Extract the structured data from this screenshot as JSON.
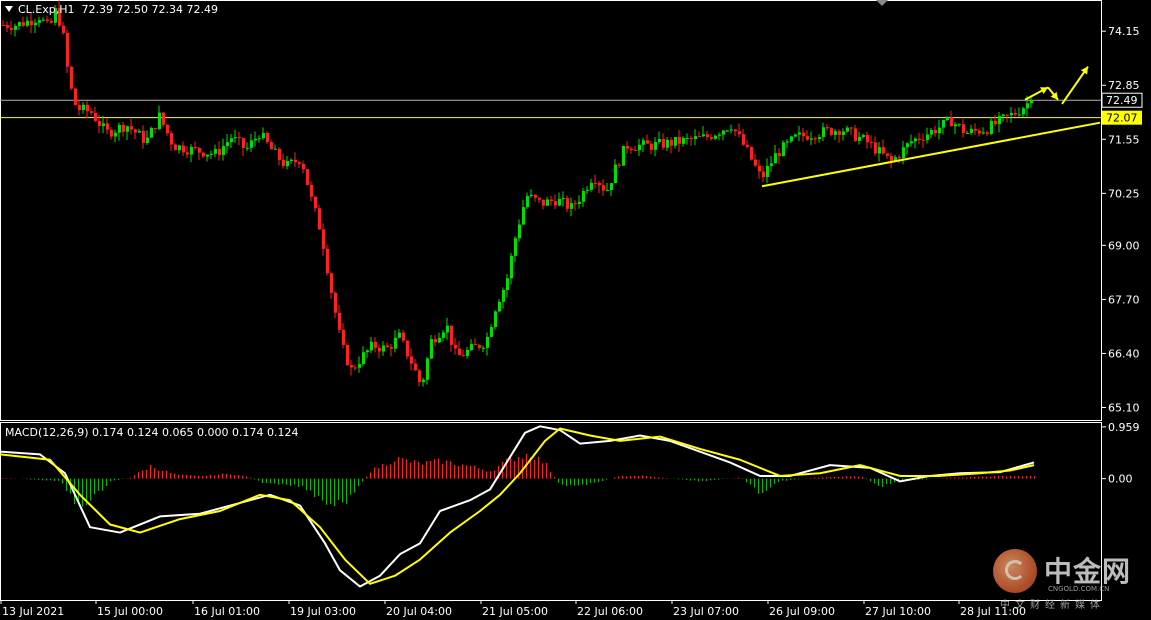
{
  "header": {
    "symbol": "CL.Exp,H1",
    "ohlc": "72.39 72.50 72.34 72.49"
  },
  "macd_header": {
    "label": "MACD(12,26,9) 0.174 0.124 0.065 0.000 0.174 0.124"
  },
  "watermark": {
    "name_cn": "中金网",
    "domain": "CNGOLD.COM.CN",
    "tagline": "中文财经新媒体",
    "logo_icon": "cngold-logo-icon"
  },
  "colors": {
    "background": "#000000",
    "bull": "#00e000",
    "bear": "#ff2020",
    "grid_line": "#b0b0b0",
    "horizontal_line": "#ffff00",
    "trend_line": "#ffff00",
    "macd_main": "#ffffff",
    "macd_signal": "#ffff00",
    "hist_pos": "#ff2020",
    "hist_neg": "#00c000"
  },
  "chart_data": [
    {
      "type": "candlestick",
      "title": "CL.Exp,H1",
      "y_ticks": [
        "74.15",
        "72.85",
        "71.55",
        "70.25",
        "69.00",
        "67.70",
        "66.40",
        "65.10"
      ],
      "ylim": [
        64.8,
        74.9
      ],
      "x_ticks": [
        "13 Jul 2021",
        "15 Jul 00:00",
        "16 Jul 01:00",
        "19 Jul 03:00",
        "20 Jul 04:00",
        "21 Jul 05:00",
        "22 Jul 06:00",
        "23 Jul 07:00",
        "26 Jul 09:00",
        "27 Jul 10:00",
        "28 Jul 11:00"
      ],
      "price_labels": [
        {
          "value": 72.49,
          "text": "72.49",
          "style": "current"
        },
        {
          "value": 72.07,
          "text": "72.07",
          "style": "horizontal-line"
        }
      ],
      "horizontal_lines": [
        {
          "value": 72.49,
          "color": "#b0b0b0"
        },
        {
          "value": 72.07,
          "color": "#ffff00"
        }
      ],
      "trend_lines": [
        {
          "x0": 762,
          "y0": 70.42,
          "x1": 1100,
          "y1": 71.95
        }
      ],
      "anchors": [
        {
          "x": 0,
          "v": 74.3
        },
        {
          "x": 15,
          "v": 74.3
        },
        {
          "x": 28,
          "v": 74.4
        },
        {
          "x": 38,
          "v": 74.5
        },
        {
          "x": 48,
          "v": 74.2
        },
        {
          "x": 55,
          "v": 74.7
        },
        {
          "x": 62,
          "v": 74.0
        },
        {
          "x": 68,
          "v": 72.9
        },
        {
          "x": 75,
          "v": 72.3
        },
        {
          "x": 90,
          "v": 72.2
        },
        {
          "x": 105,
          "v": 71.7
        },
        {
          "x": 125,
          "v": 71.9
        },
        {
          "x": 145,
          "v": 71.5
        },
        {
          "x": 158,
          "v": 72.1
        },
        {
          "x": 172,
          "v": 71.4
        },
        {
          "x": 190,
          "v": 71.3
        },
        {
          "x": 215,
          "v": 71.2
        },
        {
          "x": 230,
          "v": 71.6
        },
        {
          "x": 245,
          "v": 71.3
        },
        {
          "x": 258,
          "v": 71.7
        },
        {
          "x": 270,
          "v": 71.3
        },
        {
          "x": 285,
          "v": 70.9
        },
        {
          "x": 300,
          "v": 71.1
        },
        {
          "x": 310,
          "v": 70.1
        },
        {
          "x": 320,
          "v": 69.3
        },
        {
          "x": 330,
          "v": 67.9
        },
        {
          "x": 340,
          "v": 66.6
        },
        {
          "x": 350,
          "v": 66.0
        },
        {
          "x": 360,
          "v": 66.3
        },
        {
          "x": 372,
          "v": 66.6
        },
        {
          "x": 385,
          "v": 66.5
        },
        {
          "x": 398,
          "v": 66.8
        },
        {
          "x": 410,
          "v": 66.2
        },
        {
          "x": 420,
          "v": 65.6
        },
        {
          "x": 430,
          "v": 66.7
        },
        {
          "x": 445,
          "v": 67.1
        },
        {
          "x": 455,
          "v": 66.3
        },
        {
          "x": 470,
          "v": 66.5
        },
        {
          "x": 485,
          "v": 66.7
        },
        {
          "x": 495,
          "v": 67.6
        },
        {
          "x": 505,
          "v": 68.1
        },
        {
          "x": 515,
          "v": 69.3
        },
        {
          "x": 525,
          "v": 70.2
        },
        {
          "x": 540,
          "v": 70.0
        },
        {
          "x": 555,
          "v": 70.1
        },
        {
          "x": 570,
          "v": 69.9
        },
        {
          "x": 580,
          "v": 70.2
        },
        {
          "x": 592,
          "v": 70.7
        },
        {
          "x": 605,
          "v": 70.3
        },
        {
          "x": 615,
          "v": 70.9
        },
        {
          "x": 625,
          "v": 71.4
        },
        {
          "x": 650,
          "v": 71.4
        },
        {
          "x": 680,
          "v": 71.5
        },
        {
          "x": 705,
          "v": 71.6
        },
        {
          "x": 730,
          "v": 71.9
        },
        {
          "x": 745,
          "v": 71.3
        },
        {
          "x": 760,
          "v": 70.6
        },
        {
          "x": 775,
          "v": 71.2
        },
        {
          "x": 795,
          "v": 71.6
        },
        {
          "x": 815,
          "v": 71.7
        },
        {
          "x": 840,
          "v": 71.8
        },
        {
          "x": 865,
          "v": 71.5
        },
        {
          "x": 890,
          "v": 71.0
        },
        {
          "x": 910,
          "v": 71.5
        },
        {
          "x": 935,
          "v": 71.8
        },
        {
          "x": 950,
          "v": 72.0
        },
        {
          "x": 965,
          "v": 71.7
        },
        {
          "x": 985,
          "v": 71.8
        },
        {
          "x": 1000,
          "v": 72.0
        },
        {
          "x": 1015,
          "v": 72.2
        },
        {
          "x": 1030,
          "v": 72.49
        }
      ],
      "arrows": [
        {
          "x0": 1025,
          "y0": 72.5,
          "x1": 1048,
          "y1": 72.8
        },
        {
          "x0": 1048,
          "y0": 72.8,
          "x1": 1058,
          "y1": 72.5
        },
        {
          "x0": 1062,
          "y0": 72.4,
          "x1": 1088,
          "y1": 73.3
        }
      ]
    },
    {
      "type": "line",
      "title": "MACD(12,26,9)",
      "y_ticks": [
        "0.959",
        "0.00"
      ],
      "ylim": [
        -2.25,
        1.05
      ],
      "series": [
        {
          "name": "MACD",
          "points": [
            [
              0,
              0.5
            ],
            [
              40,
              0.45
            ],
            [
              65,
              0.1
            ],
            [
              90,
              -0.9
            ],
            [
              120,
              -1.0
            ],
            [
              160,
              -0.7
            ],
            [
              200,
              -0.65
            ],
            [
              240,
              -0.45
            ],
            [
              270,
              -0.3
            ],
            [
              300,
              -0.5
            ],
            [
              325,
              -1.2
            ],
            [
              340,
              -1.7
            ],
            [
              360,
              -2.0
            ],
            [
              380,
              -1.8
            ],
            [
              400,
              -1.4
            ],
            [
              420,
              -1.2
            ],
            [
              440,
              -0.6
            ],
            [
              470,
              -0.4
            ],
            [
              490,
              -0.2
            ],
            [
              510,
              0.4
            ],
            [
              525,
              0.85
            ],
            [
              540,
              0.97
            ],
            [
              560,
              0.9
            ],
            [
              580,
              0.65
            ],
            [
              610,
              0.7
            ],
            [
              640,
              0.8
            ],
            [
              670,
              0.7
            ],
            [
              700,
              0.5
            ],
            [
              730,
              0.3
            ],
            [
              760,
              0.05
            ],
            [
              790,
              0.05
            ],
            [
              830,
              0.25
            ],
            [
              870,
              0.2
            ],
            [
              900,
              -0.05
            ],
            [
              930,
              0.05
            ],
            [
              960,
              0.1
            ],
            [
              1000,
              0.12
            ],
            [
              1034,
              0.3
            ]
          ]
        },
        {
          "name": "Signal",
          "points": [
            [
              0,
              0.45
            ],
            [
              50,
              0.35
            ],
            [
              80,
              -0.3
            ],
            [
              110,
              -0.85
            ],
            [
              140,
              -1.0
            ],
            [
              180,
              -0.75
            ],
            [
              220,
              -0.6
            ],
            [
              260,
              -0.3
            ],
            [
              290,
              -0.4
            ],
            [
              320,
              -0.9
            ],
            [
              345,
              -1.5
            ],
            [
              370,
              -1.95
            ],
            [
              395,
              -1.8
            ],
            [
              420,
              -1.5
            ],
            [
              450,
              -1.0
            ],
            [
              480,
              -0.6
            ],
            [
              500,
              -0.3
            ],
            [
              520,
              0.1
            ],
            [
              545,
              0.7
            ],
            [
              560,
              0.93
            ],
            [
              590,
              0.8
            ],
            [
              620,
              0.7
            ],
            [
              660,
              0.78
            ],
            [
              700,
              0.55
            ],
            [
              740,
              0.35
            ],
            [
              780,
              0.05
            ],
            [
              820,
              0.1
            ],
            [
              860,
              0.25
            ],
            [
              900,
              0.05
            ],
            [
              940,
              0.05
            ],
            [
              980,
              0.1
            ],
            [
              1010,
              0.15
            ],
            [
              1034,
              0.25
            ]
          ]
        }
      ],
      "histogram_envelope": [
        [
          0,
          0.02
        ],
        [
          60,
          -0.05
        ],
        [
          75,
          -0.5
        ],
        [
          90,
          -0.45
        ],
        [
          110,
          -0.05
        ],
        [
          130,
          0.02
        ],
        [
          150,
          0.25
        ],
        [
          175,
          0.08
        ],
        [
          200,
          0.05
        ],
        [
          230,
          0.1
        ],
        [
          250,
          0.02
        ],
        [
          265,
          -0.1
        ],
        [
          300,
          -0.15
        ],
        [
          330,
          -0.5
        ],
        [
          345,
          -0.45
        ],
        [
          360,
          -0.1
        ],
        [
          370,
          0.15
        ],
        [
          395,
          0.4
        ],
        [
          420,
          0.3
        ],
        [
          440,
          0.35
        ],
        [
          470,
          0.25
        ],
        [
          490,
          0.15
        ],
        [
          510,
          0.4
        ],
        [
          530,
          0.5
        ],
        [
          545,
          0.3
        ],
        [
          560,
          -0.15
        ],
        [
          590,
          -0.1
        ],
        [
          620,
          0.05
        ],
        [
          640,
          0.06
        ],
        [
          660,
          0.02
        ],
        [
          700,
          -0.05
        ],
        [
          740,
          0.02
        ],
        [
          760,
          -0.3
        ],
        [
          780,
          -0.05
        ],
        [
          820,
          0.03
        ],
        [
          860,
          0.05
        ],
        [
          880,
          -0.15
        ],
        [
          900,
          -0.05
        ],
        [
          950,
          0.02
        ],
        [
          1000,
          0.05
        ],
        [
          1034,
          0.05
        ]
      ]
    }
  ]
}
